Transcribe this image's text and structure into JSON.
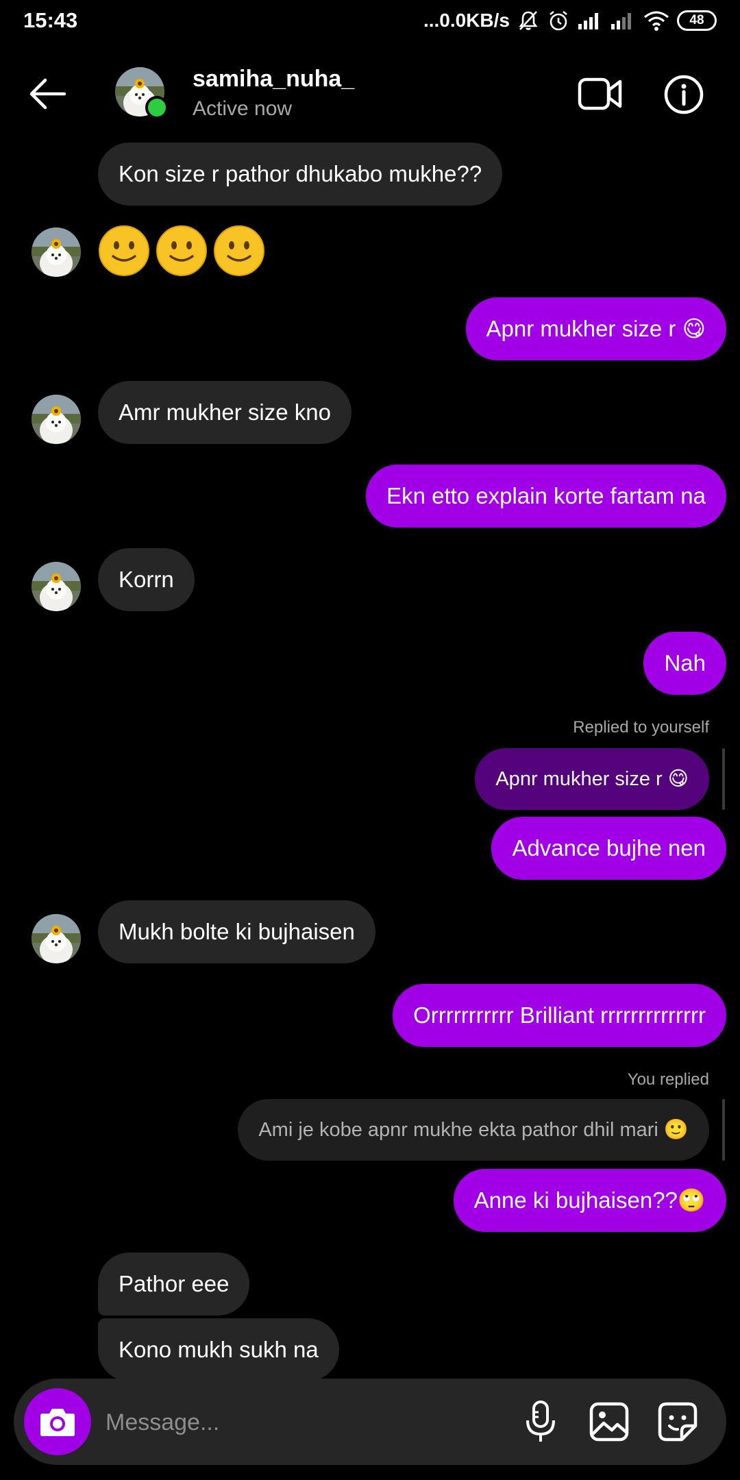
{
  "status_bar": {
    "time": "15:43",
    "network_speed": "...0.0KB/s",
    "battery": "48",
    "icons": [
      "mute-icon",
      "alarm-icon",
      "signal-icon",
      "signal-icon",
      "wifi-icon",
      "battery-icon"
    ]
  },
  "header": {
    "username": "samiha_nuha_",
    "active_status": "Active now",
    "icons": [
      "back-arrow-icon",
      "video-call-icon",
      "info-icon"
    ]
  },
  "messages": {
    "m1": "Kon size r pathor dhukabo mukhe??",
    "m2_emoji": "🙂🙂🙂",
    "m3": "Apnr mukher size r 😋",
    "m4": "Amr mukher size kno",
    "m5": "Ekn etto explain korte fartam na",
    "m6": "Korrn",
    "m7": "Nah",
    "reply1_label": "Replied to yourself",
    "reply1_quote": "Apnr mukher size r 😋",
    "m8": "Advance bujhe nen",
    "m9": "Mukh bolte ki bujhaisen",
    "m10": "Orrrrrrrrrrr Brilliant rrrrrrrrrrrrrr",
    "reply2_label": "You replied",
    "reply2_quote": "Ami je kobe apnr mukhe ekta pathor dhil mari 🙂",
    "m11": "Anne ki bujhaisen??🙄",
    "m12": "Pathor eee",
    "m13": "Kono mukh sukh na"
  },
  "composer": {
    "placeholder": "Message...",
    "icons": [
      "camera-icon",
      "microphone-icon",
      "gallery-icon",
      "sticker-icon"
    ]
  },
  "colors": {
    "background": "#000000",
    "outgoing_bubble": "#a100e6",
    "incoming_bubble": "#262626",
    "online": "#2ecc40"
  }
}
